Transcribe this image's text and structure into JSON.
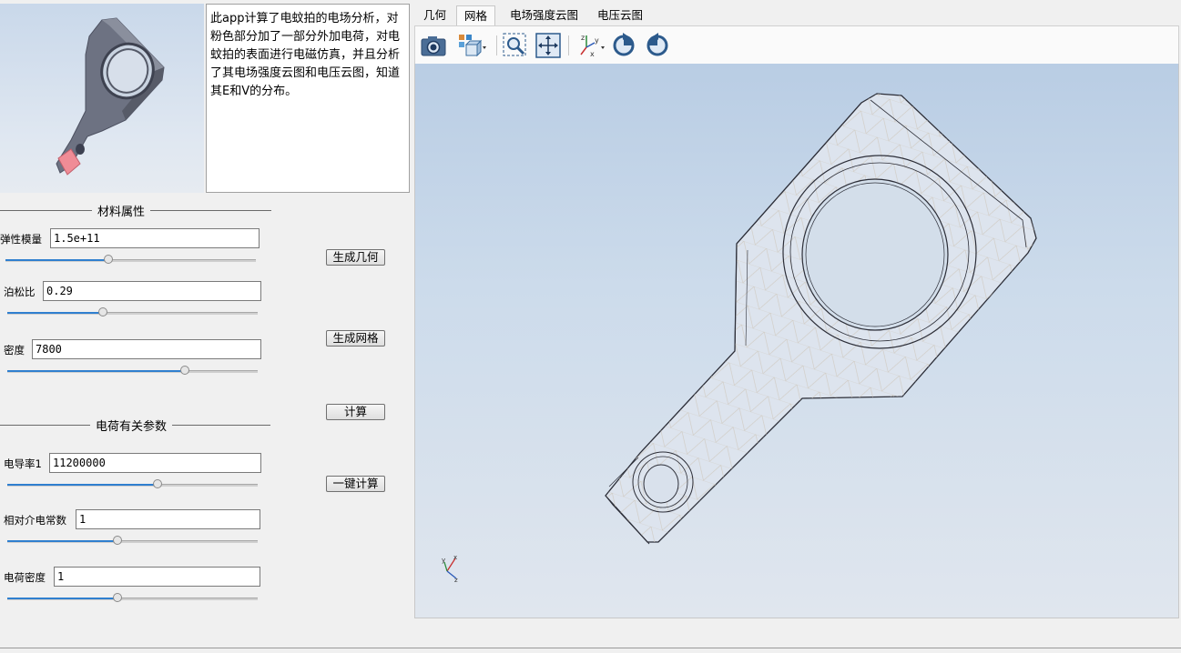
{
  "description": "此app计算了电蚊拍的电场分析，对粉色部分加了一部分外加电荷，对电蚊拍的表面进行电磁仿真，并且分析了其电场强度云图和电压云图，知道其E和V的分布。",
  "material_section": {
    "title": "材料属性",
    "params": [
      {
        "label": "弹性模量",
        "value": "1.5e+11",
        "slider": 0.41
      },
      {
        "label": "泊松比",
        "value": "0.29",
        "slider": 0.38
      },
      {
        "label": "密度",
        "value": "7800",
        "slider": 0.71
      }
    ]
  },
  "charge_section": {
    "title": "电荷有关参数",
    "params": [
      {
        "label": "电导率1",
        "value": "11200000",
        "slider": 0.6
      },
      {
        "label": "相对介电常数",
        "value": "1",
        "slider": 0.44
      },
      {
        "label": "电荷密度",
        "value": "1",
        "slider": 0.44
      }
    ]
  },
  "buttons": {
    "geometry": "生成几何",
    "mesh": "生成网格",
    "compute": "计算",
    "one_click": "一键计算"
  },
  "tabs": [
    "几何",
    "网格",
    "电场强度云图",
    "电压云图"
  ],
  "active_tab": 1,
  "toolbar_icons": [
    "camera-icon",
    "view-cube-icon",
    "zoom-box-icon",
    "zoom-extents-icon",
    "axis-orientation-icon",
    "rotate-ccw-icon",
    "rotate-cw-icon"
  ],
  "axis_labels": {
    "x": "x",
    "y": "y",
    "z": "z"
  },
  "colors": {
    "accent": "#2f7fcf",
    "model": "#6d7280",
    "charge_region": "#f08c96"
  }
}
